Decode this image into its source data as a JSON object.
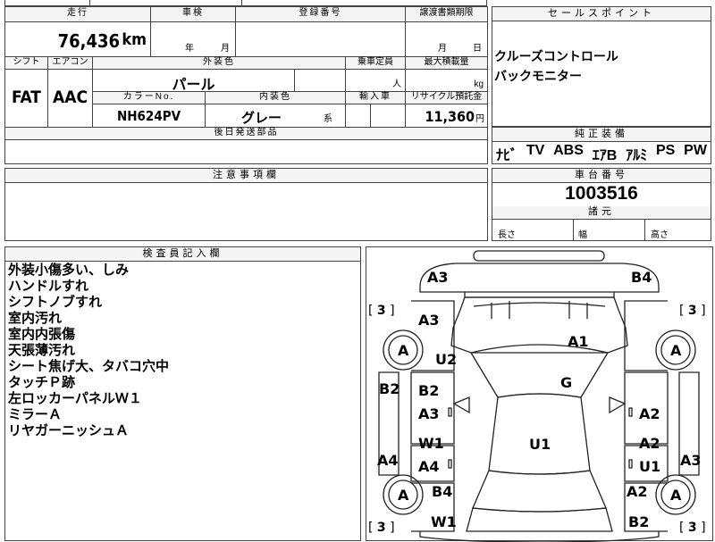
{
  "top_fragment": "",
  "vehicle": {
    "mileage_label": "走行",
    "mileage": "76,436",
    "mileage_unit": "km",
    "shaken_label": "車検",
    "shaken_year": "年",
    "shaken_month": "月",
    "reg_label": "登録番号",
    "transfer_label": "譲渡書類期限",
    "transfer_month": "月",
    "transfer_day": "日",
    "shift_label": "シフト",
    "aircon_label": "エアコン",
    "ext_color_label": "外装色",
    "capacity_label": "乗車定員",
    "max_load_label": "最大積載量",
    "shift": "FAT",
    "aircon": "AAC",
    "ext_color": "パール",
    "capacity_unit": "人",
    "load_unit": "kg",
    "color_no_label": "カラーNo.",
    "int_color_label": "内装色",
    "import_label": "輸入車",
    "recycle_label": "リサイクル預託金",
    "color_no": "NH624PV",
    "int_color": "グレー",
    "int_color_suffix": "系",
    "recycle": "11,360",
    "recycle_unit": "円",
    "later_parts_label": "後日発送部品"
  },
  "sales_point": {
    "title": "セールスポイント",
    "lines": [
      "クルーズコントロール",
      "バックモニター"
    ]
  },
  "equipment": {
    "title": "純正装備",
    "items": [
      "ﾅﾋﾞ",
      "TV",
      "ABS",
      "ｴｱB",
      "ｱﾙﾐ",
      "PS",
      "PW"
    ]
  },
  "caution": {
    "title": "注意事項欄"
  },
  "chassis": {
    "title": "車台番号",
    "number": "1003516",
    "dims_title": "諸元",
    "length_label": "長さ",
    "width_label": "幅",
    "height_label": "高さ"
  },
  "inspector": {
    "title": "検査員記入欄",
    "notes": [
      "外装小傷多い、しみ",
      "ハンドルすれ",
      "シフトノブすれ",
      "室内汚れ",
      "室内内張傷",
      "天張薄汚れ",
      "シート焦げ大、タバコ穴中",
      "タッチＰ跡",
      "左ロッカーパネルＷ１",
      "ミラーＡ",
      "リヤガーニッシュＡ"
    ]
  },
  "diagram": {
    "codes": {
      "front_bumper_left": "A3",
      "front_bumper_right": "B4",
      "hood_left": "A3",
      "roof": "A1",
      "windshield_left": "U2",
      "interior": "G",
      "left_front_door_top": "B2",
      "left_front_door_bottom": "A3",
      "left_fender": "B2",
      "right_front_door": "A2",
      "left_rear_door_top": "W1",
      "left_rear_door_bottom": "A4",
      "left_rocker": "A4",
      "center": "U1",
      "right_rear_door_top": "A2",
      "right_rear_door_bottom": "U1",
      "right_rocker": "A3",
      "left_quarter": "B4",
      "right_quarter": "A2",
      "rear_left": "W1",
      "rear_right": "B2"
    },
    "wheel_label": "A",
    "tire_depth": "3"
  }
}
